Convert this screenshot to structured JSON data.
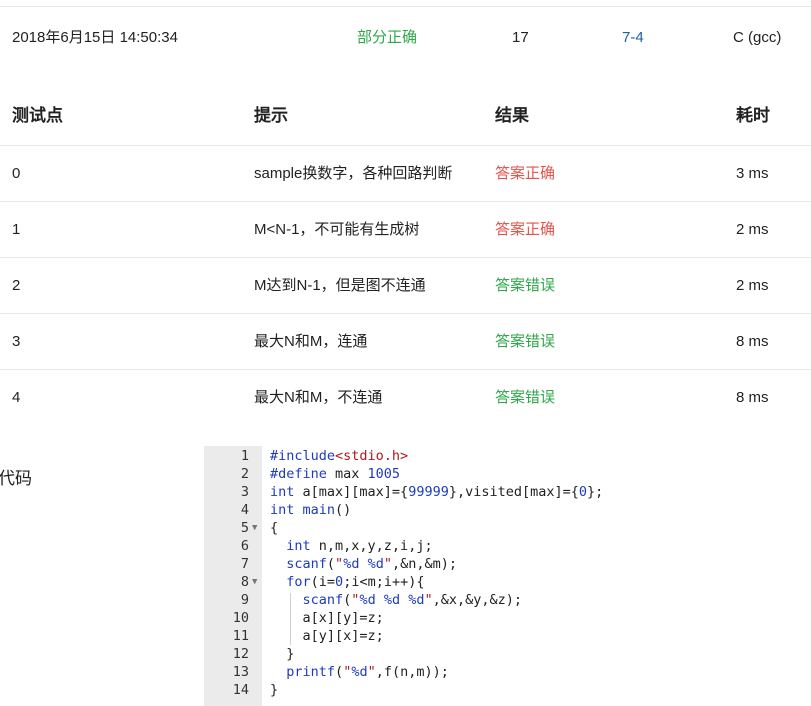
{
  "submission": {
    "time": "2018年6月15日 14:50:34",
    "status": "部分正确",
    "score": "17",
    "problem": "7-4",
    "compiler": "C (gcc)"
  },
  "table": {
    "headers": [
      "测试点",
      "提示",
      "结果",
      "耗时"
    ],
    "rows": [
      {
        "id": "0",
        "hint": "sample换数字，各种回路判断",
        "result": "答案正确",
        "time": "3 ms",
        "ok": true
      },
      {
        "id": "1",
        "hint": "M<N-1，不可能有生成树",
        "result": "答案正确",
        "time": "2 ms",
        "ok": true
      },
      {
        "id": "2",
        "hint": "M达到N-1，但是图不连通",
        "result": "答案错误",
        "time": "2 ms",
        "ok": false
      },
      {
        "id": "3",
        "hint": "最大N和M，连通",
        "result": "答案错误",
        "time": "8 ms",
        "ok": false
      },
      {
        "id": "4",
        "hint": "最大N和M，不连通",
        "result": "答案错误",
        "time": "8 ms",
        "ok": false
      }
    ]
  },
  "code_label": "代码",
  "code_lines": [
    "#include<stdio.h>",
    "#define max 1005",
    "int a[max][max]={99999},visited[max]={0};",
    "int main()",
    "{",
    "  int n,m,x,y,z,i,j;",
    "  scanf(\"%d %d\",&n,&m);",
    "  for(i=0;i<m;i++){",
    "    scanf(\"%d %d %d\",&x,&y,&z);",
    "    a[x][y]=z;",
    "    a[y][x]=z;",
    "  }",
    "  printf(\"%d\",f(n,m));",
    "}"
  ],
  "colors": {
    "correct": "#e4534a",
    "wrong": "#2ea84a",
    "partial": "#2ea84a",
    "problem_link": "#1f5fa8"
  }
}
